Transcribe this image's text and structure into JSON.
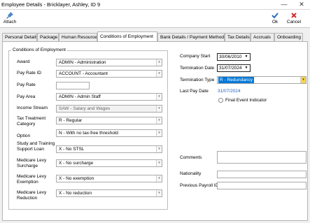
{
  "window": {
    "title": "Employee Details - Bricklayer, Ashley, ID 9",
    "minimize": "—",
    "close": "✕"
  },
  "toolbar": {
    "attach_label": "Attach",
    "attach_icon": "pin-icon",
    "ok_label": "Ok",
    "ok_icon": "check-icon",
    "cancel_label": "Cancel",
    "cancel_icon": "close-x-icon"
  },
  "tabs": [
    {
      "label": "Personal Details"
    },
    {
      "label": "Package"
    },
    {
      "label": "Human Resource"
    },
    {
      "label": "Conditions of Employment",
      "active": true
    },
    {
      "label": "Bank Details / Payment Method"
    },
    {
      "label": "Tax Details"
    },
    {
      "label": "Accruals"
    },
    {
      "label": "Onboarding"
    }
  ],
  "conditions": {
    "group_title": "Conditions of Employment",
    "award_label": "Award",
    "award_value": "ADMIN - Administration",
    "pay_rate_id_label": "Pay Rate ID",
    "pay_rate_id_value": "ACCOUNT - Accountant",
    "pay_rate_label": "Pay Rate",
    "pay_rate_value": "",
    "pay_area_label": "Pay Area",
    "pay_area_value": "ADMIN - Admin Staff",
    "income_stream_label": "Income Stream",
    "income_stream_value": "SAW - Salary and Wages",
    "tax_treatment_label": "Tax Treatment Category",
    "tax_treatment_value": "R - Regular",
    "option_label": "Option",
    "option_value": "N - With no tax-free threshold",
    "stsl_label": "Study and Training Support Loan",
    "stsl_value": "X - No STSL",
    "medicare_surcharge_label": "Medicare Levy Surcharge",
    "medicare_surcharge_value": "X - No surcharge",
    "medicare_exemption_label": "Medicare Levy Exemption",
    "medicare_exemption_value": "X - No exemption",
    "medicare_reduction_label": "Medicare Levy Reduction",
    "medicare_reduction_value": "X - No reduction"
  },
  "right": {
    "company_start_label": "Company Start",
    "company_start_value": "30/06/2010",
    "termination_date_label": "Termination Date",
    "termination_date_value": "31/07/2024",
    "termination_type_label": "Termination Type",
    "termination_type_value": "R - Redundancy",
    "last_pay_date_label": "Last Pay Date",
    "last_pay_date_value": "31/07/2024",
    "final_event_label": "Final Event Indicator",
    "comments_label": "Comments",
    "nationality_label": "Nationality",
    "previous_payroll_label": "Previous Payroll ID"
  }
}
